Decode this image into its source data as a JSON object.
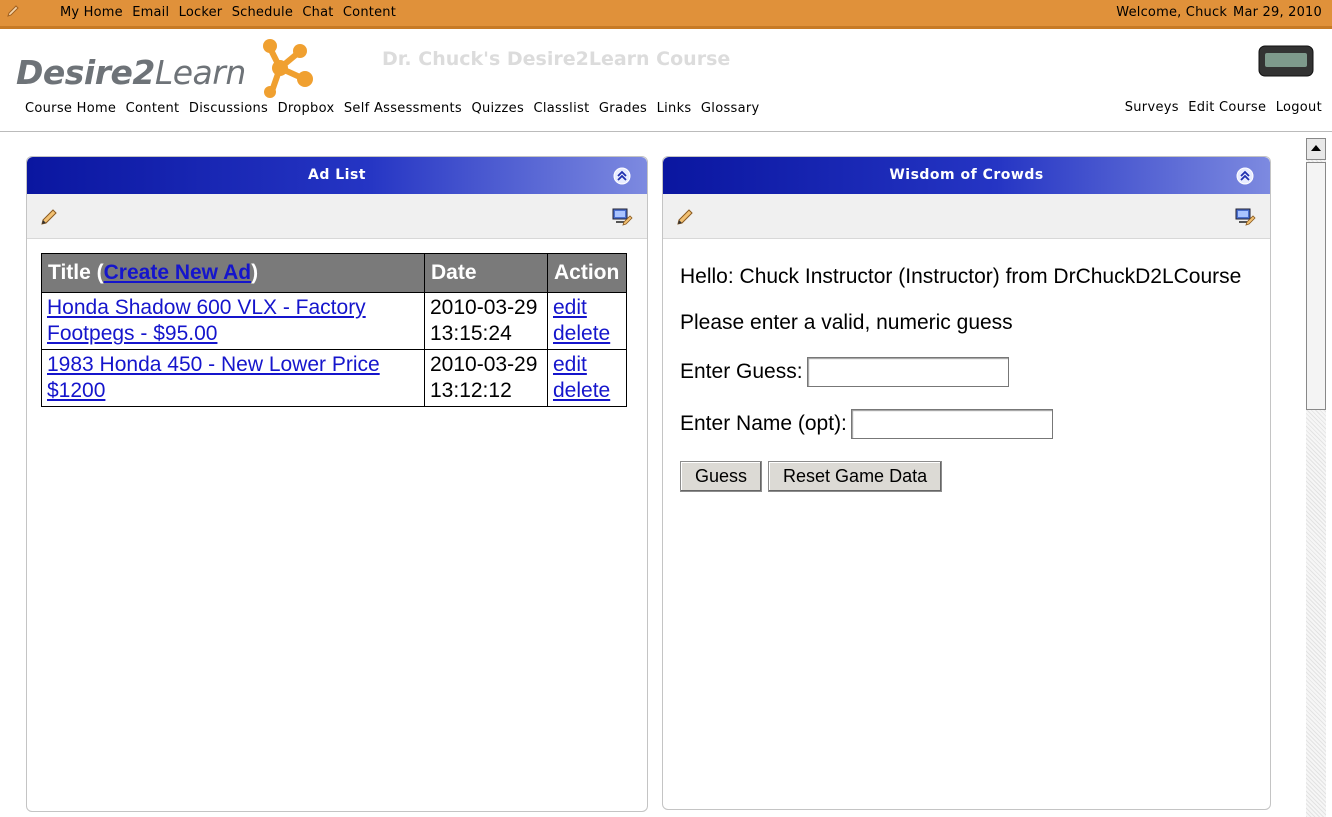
{
  "topbar": {
    "menu": [
      "My Home",
      "Email",
      "Locker",
      "Schedule",
      "Chat",
      "Content"
    ],
    "welcome": "Welcome, Chuck",
    "date": "Mar 29, 2010"
  },
  "header": {
    "logo_bold": "Desire2",
    "logo_rest": "Learn",
    "course_title": "Dr. Chuck's Desire2Learn Course",
    "nav": [
      "Course Home",
      "Content",
      "Discussions",
      "Dropbox",
      "Self Assessments",
      "Quizzes",
      "Classlist",
      "Grades",
      "Links",
      "Glossary"
    ],
    "right_nav": [
      "Surveys",
      "Edit Course",
      "Logout"
    ]
  },
  "ad_list": {
    "title": "Ad List",
    "col_title_prefix": "Title (",
    "create_link": "Create New Ad",
    "col_title_suffix": ")",
    "col_date": "Date",
    "col_action": "Action",
    "rows": [
      {
        "title": "Honda Shadow 600 VLX - Factory Footpegs - $95.00",
        "date": "2010-03-29",
        "time": "13:15:24",
        "edit": "edit",
        "delete": "delete"
      },
      {
        "title": "1983 Honda 450 - New Lower Price $1200",
        "date": "2010-03-29",
        "time": "13:12:12",
        "edit": "edit",
        "delete": "delete"
      }
    ]
  },
  "wisdom": {
    "title": "Wisdom of Crowds",
    "hello": "Hello: Chuck Instructor (Instructor) from DrChuckD2LCourse",
    "message": "Please enter a valid, numeric guess",
    "guess_label": "Enter Guess:",
    "guess_value": "",
    "name_label": "Enter Name (opt):",
    "name_value": "",
    "guess_button": "Guess",
    "reset_button": "Reset Game Data"
  },
  "colors": {
    "topbar": "#e0913a",
    "widget_header": "#0a16a0",
    "link": "#1515cc"
  }
}
